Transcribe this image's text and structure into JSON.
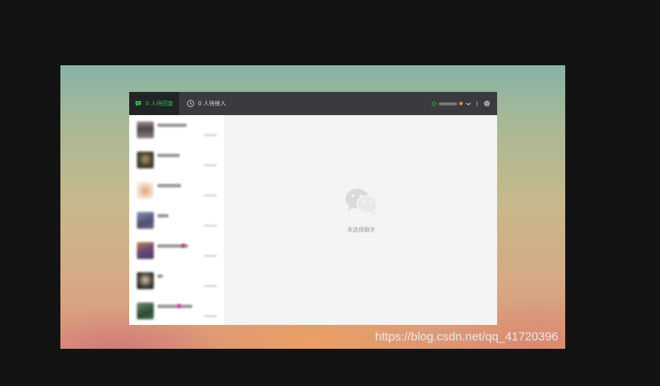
{
  "topbar": {
    "tabs": [
      {
        "label": "0 人待回复",
        "icon": "chat-bubble-icon",
        "active": true
      },
      {
        "label": "0 人待接入",
        "icon": "clock-icon",
        "active": false
      }
    ],
    "status": {
      "online_color": "#2ac24d",
      "badge_color": "#e58a2c"
    }
  },
  "conversations": [
    {
      "avatar_color": "#6a5a5c"
    },
    {
      "avatar_color": "#4a4438"
    },
    {
      "avatar_color": "#e7cfb8"
    },
    {
      "avatar_color": "#5d6280"
    },
    {
      "avatar_color": "#6d4a72"
    },
    {
      "avatar_color": "#3a3a35"
    },
    {
      "avatar_color": "#3f5a45"
    }
  ],
  "main": {
    "empty_text": "未选择聊天",
    "empty_icon": "wechat-logo-icon"
  },
  "watermark": "https://blog.csdn.net/qq_41720396",
  "colors": {
    "accent": "#27c04a",
    "topbar": "#3a3b3e",
    "active_tab": "#222325"
  }
}
